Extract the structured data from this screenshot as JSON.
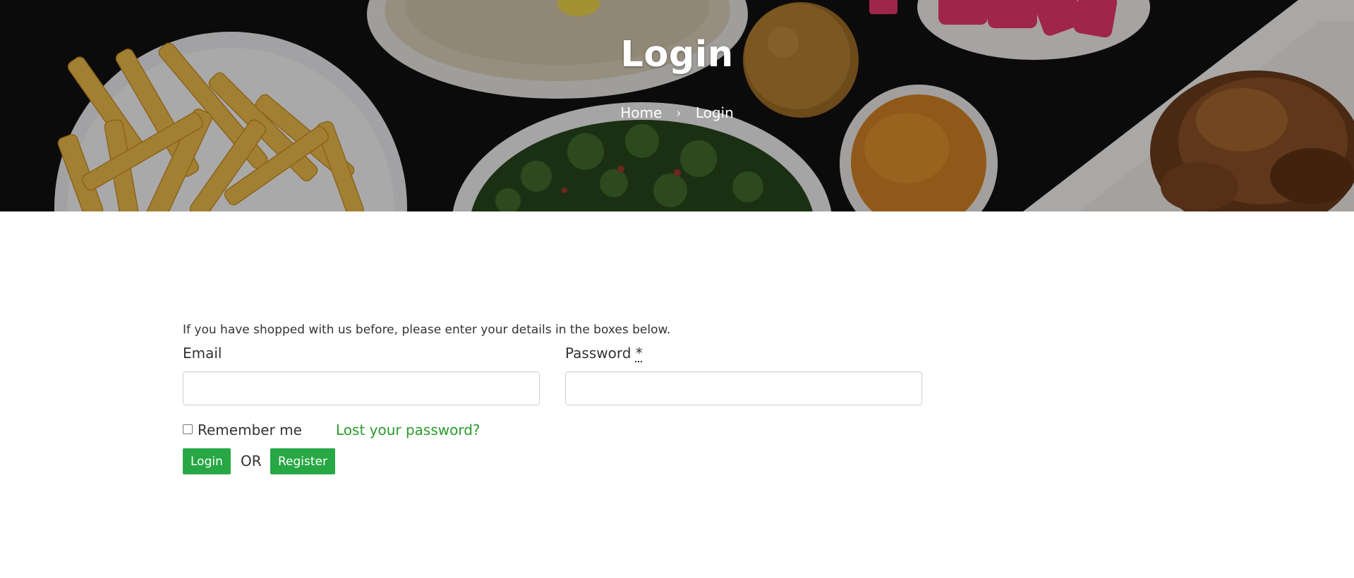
{
  "hero": {
    "title": "Login",
    "breadcrumb": {
      "home": "Home",
      "separator": "›",
      "current": "Login"
    }
  },
  "form": {
    "intro": "If you have shopped with us before, please enter your details in the boxes below.",
    "email_label": "Email",
    "email_value": "",
    "password_label": "Password",
    "password_required_mark": "*",
    "password_value": "",
    "remember_label": "Remember me",
    "remember_checked": false,
    "lost_password": "Lost your password?",
    "login_button": "Login",
    "or_text": "OR",
    "register_button": "Register"
  },
  "colors": {
    "accent_green": "#28a745",
    "link_green": "#2a9b2a",
    "text": "#333333"
  }
}
